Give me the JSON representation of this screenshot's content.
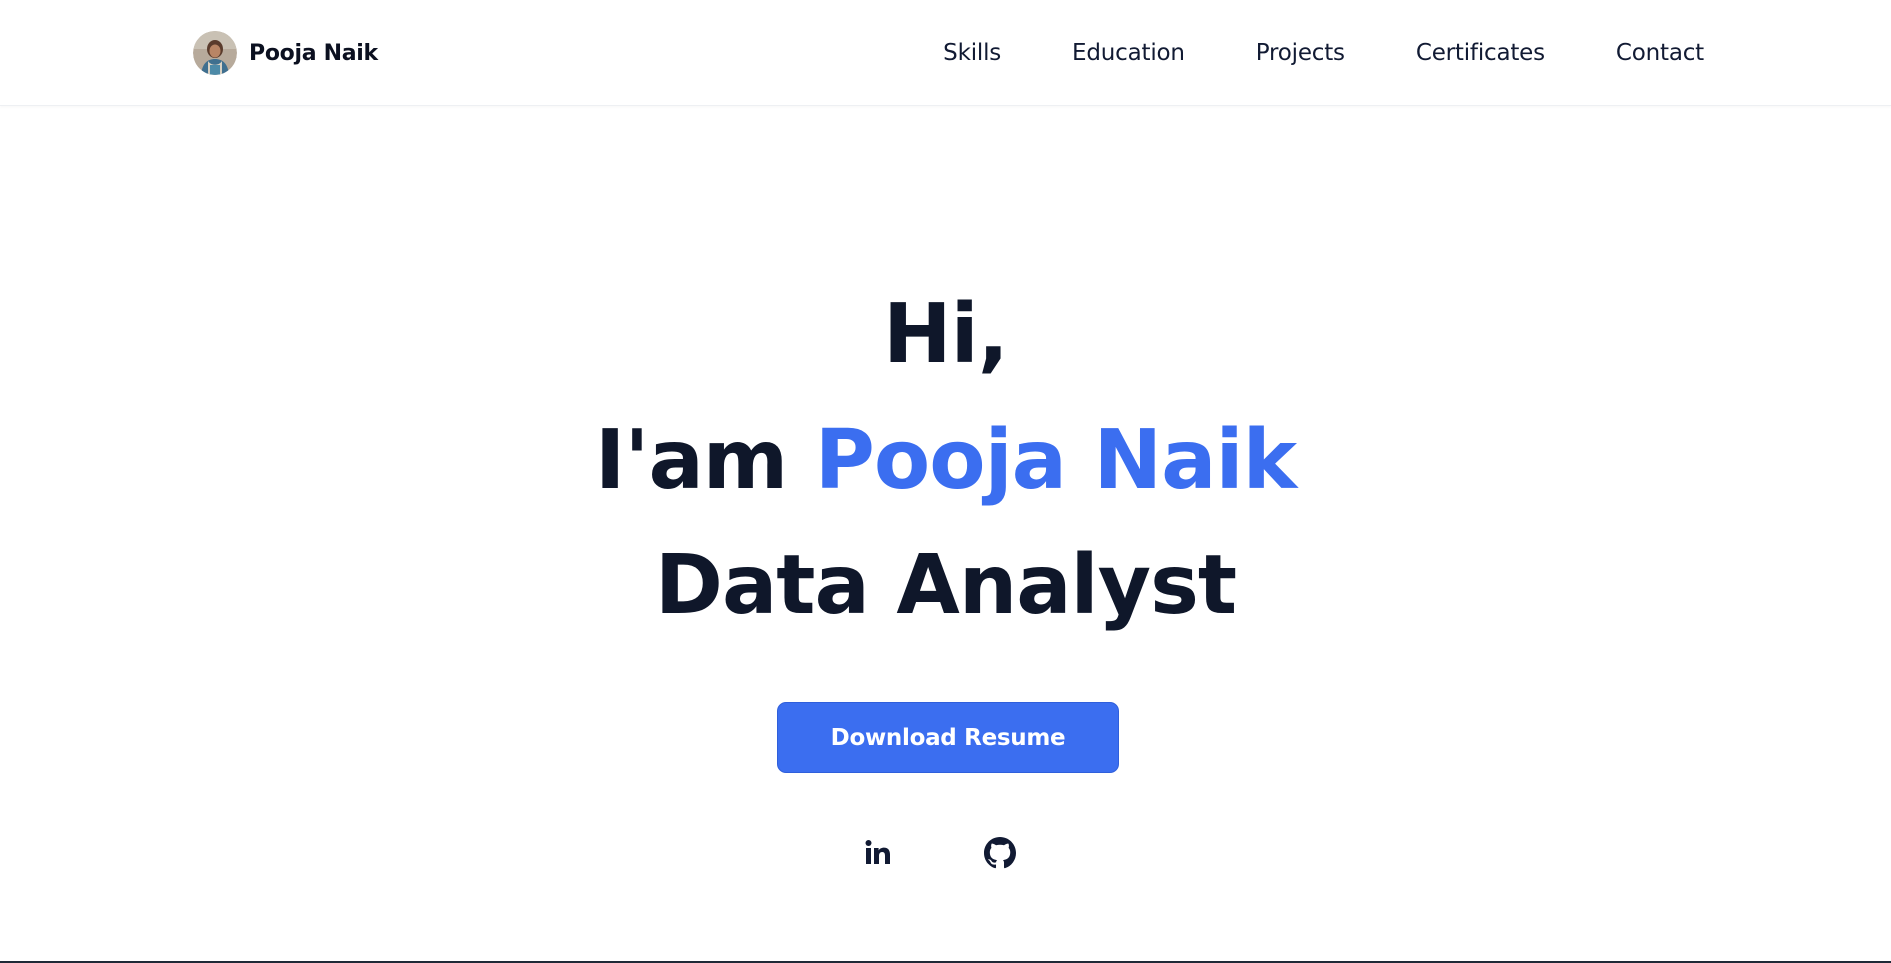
{
  "header": {
    "brand_name": "Pooja Naik",
    "nav": [
      {
        "label": "Skills"
      },
      {
        "label": "Education"
      },
      {
        "label": "Projects"
      },
      {
        "label": "Certificates"
      },
      {
        "label": "Contact"
      }
    ]
  },
  "hero": {
    "greeting": "Hi,",
    "intro_prefix": "I'am",
    "name": "Pooja Naik",
    "role": "Data Analyst",
    "download_label": "Download Resume",
    "social": [
      {
        "icon": "linkedin-icon"
      },
      {
        "icon": "github-icon"
      }
    ]
  },
  "colors": {
    "accent": "#3b6ef0",
    "text": "#0f172a",
    "background": "#ffffff"
  }
}
